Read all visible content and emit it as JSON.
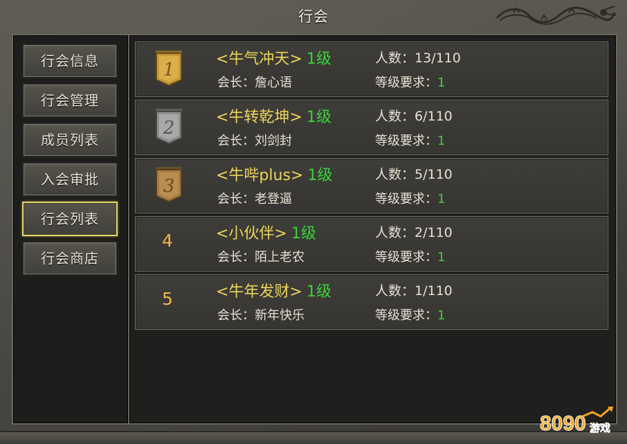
{
  "window": {
    "title": "行会"
  },
  "sidebar": {
    "items": [
      {
        "label": "行会信息",
        "active": false
      },
      {
        "label": "行会管理",
        "active": false
      },
      {
        "label": "成员列表",
        "active": false
      },
      {
        "label": "入会审批",
        "active": false
      },
      {
        "label": "行会列表",
        "active": true
      },
      {
        "label": "行会商店",
        "active": false
      }
    ]
  },
  "guilds": [
    {
      "rank": "1",
      "badge": "gold-badge-icon",
      "name": "<牛气冲天>",
      "level": "1级",
      "leader_label": "会长：",
      "leader": "詹心语",
      "members_label": "人数：",
      "members": "13/110",
      "req_label": "等级要求：",
      "req": "1"
    },
    {
      "rank": "2",
      "badge": "silver-badge-icon",
      "name": "<牛转乾坤>",
      "level": "1级",
      "leader_label": "会长：",
      "leader": "刘剑封",
      "members_label": "人数：",
      "members": "6/110",
      "req_label": "等级要求：",
      "req": "1"
    },
    {
      "rank": "3",
      "badge": "bronze-badge-icon",
      "name": "<牛哔plus>",
      "level": "1级",
      "leader_label": "会长：",
      "leader": "老登逼",
      "members_label": "人数：",
      "members": "5/110",
      "req_label": "等级要求：",
      "req": "1"
    },
    {
      "rank": "4",
      "badge": "",
      "name": "<小伙伴>",
      "level": "1级",
      "leader_label": "会长：",
      "leader": "陌上老农",
      "members_label": "人数：",
      "members": "2/110",
      "req_label": "等级要求：",
      "req": "1"
    },
    {
      "rank": "5",
      "badge": "",
      "name": "<牛年发财>",
      "level": "1级",
      "leader_label": "会长：",
      "leader": "新年快乐",
      "members_label": "人数：",
      "members": "1/110",
      "req_label": "等级要求：",
      "req": "1"
    }
  ],
  "watermark": {
    "text": "8090",
    "subtext": "游戏"
  },
  "colors": {
    "guild_name": "#ecd45a",
    "level": "#3bd33b",
    "rank_number": "#f0b64c",
    "active_border": "#e3d56c"
  }
}
